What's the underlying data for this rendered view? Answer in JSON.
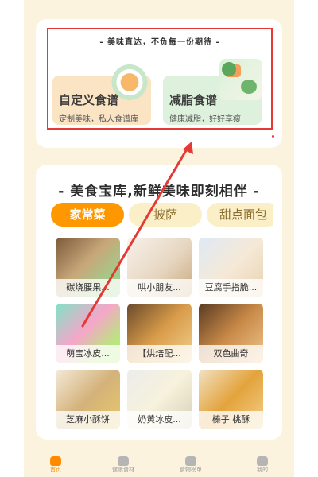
{
  "top_card": {
    "slogan": "- 美味直达，不负每一份期待 -",
    "features": [
      {
        "title": "自定义食谱",
        "subtitle": "定制美味，私人食谱库"
      },
      {
        "title": "减脂食谱",
        "subtitle": "健康减脂，好好享瘦"
      }
    ]
  },
  "main": {
    "title": "- 美食宝库,新鲜美味即刻相伴 -",
    "tabs": [
      {
        "label": "家常菜",
        "active": true
      },
      {
        "label": "披萨",
        "active": false
      },
      {
        "label": "甜点面包",
        "active": false
      }
    ],
    "recipes": [
      {
        "name": "碳烧腰果..."
      },
      {
        "name": "哄小朋友..."
      },
      {
        "name": "豆腐手指脆..."
      },
      {
        "name": "萌宝冰皮..."
      },
      {
        "name": "【烘焙配..."
      },
      {
        "name": "双色曲奇"
      },
      {
        "name": "芝麻小酥饼"
      },
      {
        "name": "奶黄冰皮..."
      },
      {
        "name": "榛子 桃酥"
      }
    ]
  },
  "tabbar": {
    "items": [
      {
        "label": "首页",
        "icon": "home-icon",
        "active": true
      },
      {
        "label": "健康食材",
        "icon": "ingredient-icon",
        "active": false
      },
      {
        "label": "食物榜单",
        "icon": "ranking-icon",
        "active": false
      },
      {
        "label": "我的",
        "icon": "profile-icon",
        "active": false
      }
    ]
  },
  "colors": {
    "accent": "#ff9800",
    "highlight": "#e53935",
    "background": "#fbf3de"
  }
}
